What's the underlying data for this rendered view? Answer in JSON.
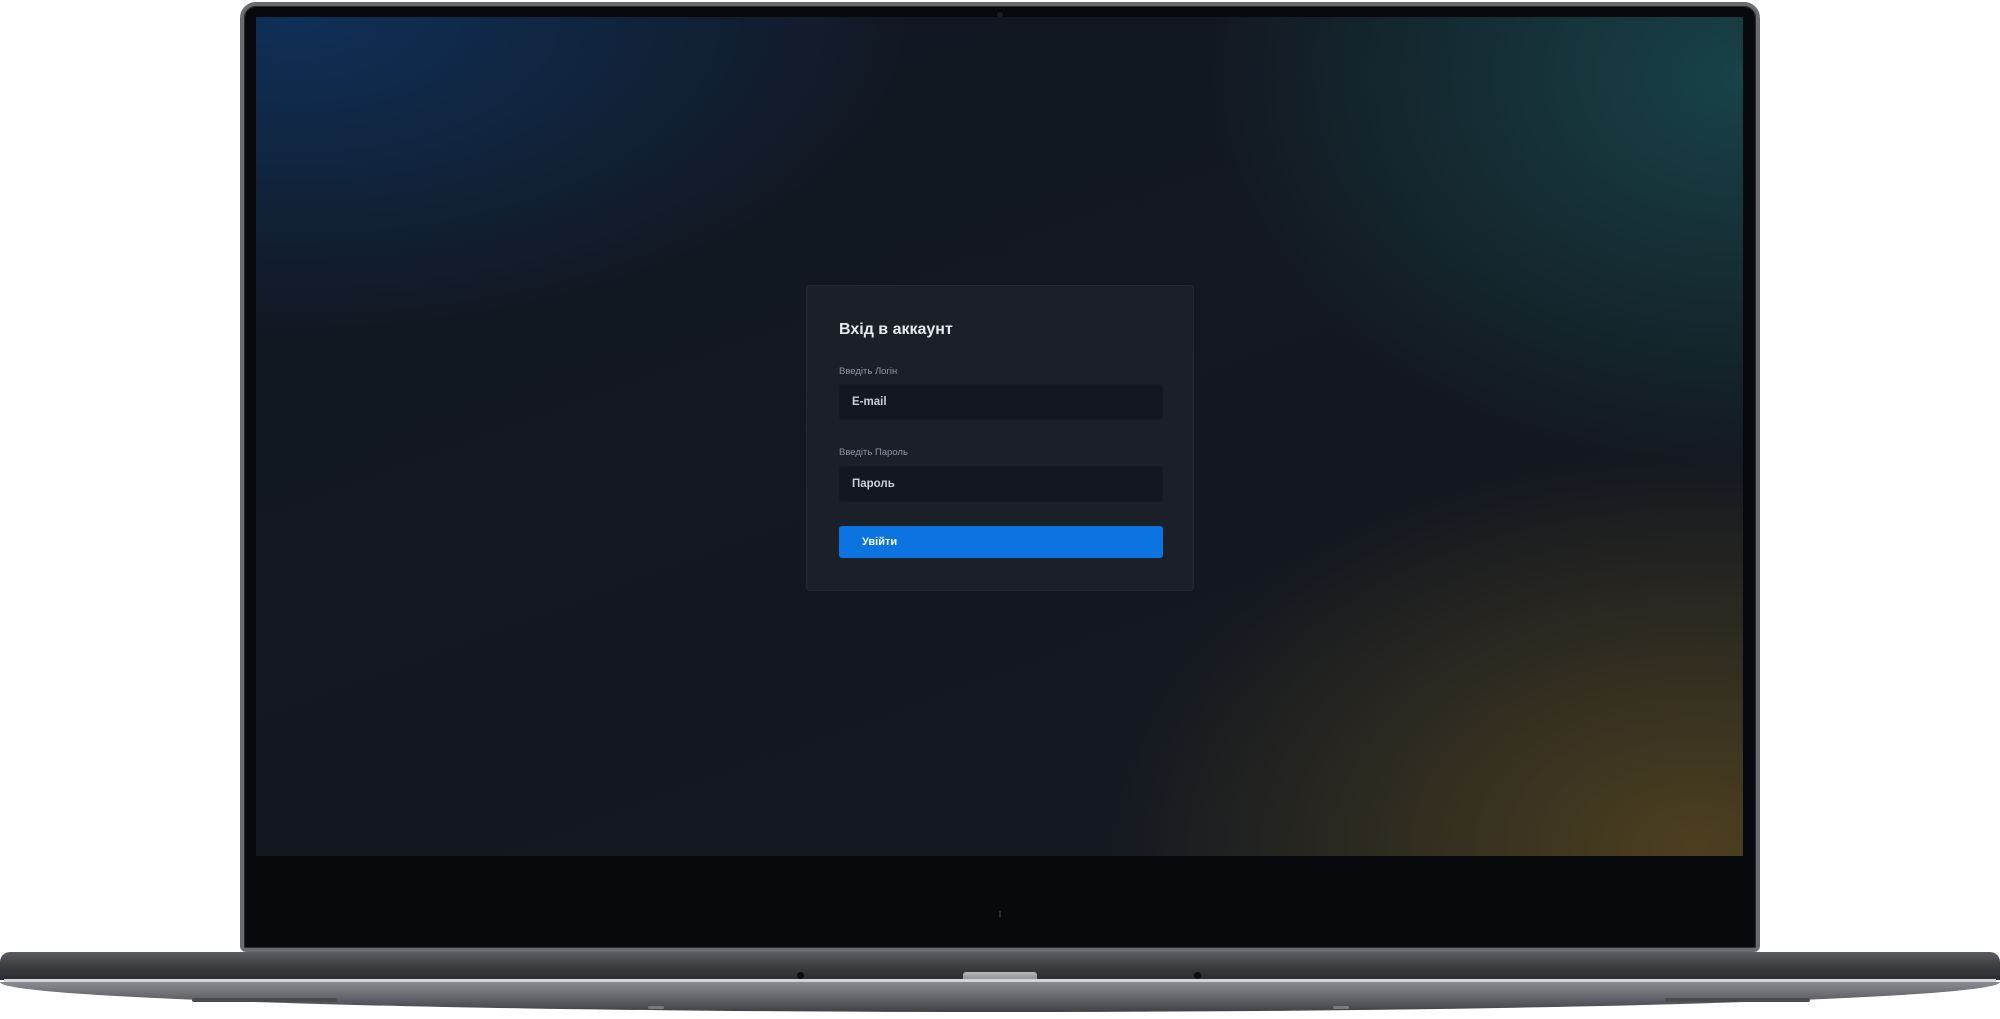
{
  "login": {
    "title": "Вхід в аккаунт",
    "login_label": "Введіть Логін",
    "login_placeholder": "E-mail",
    "password_label": "Введіть Пароль",
    "password_placeholder": "Пароль",
    "submit_label": "Увійти"
  },
  "colors": {
    "accent": "#0b74e0",
    "card_background": "#1b1f28",
    "input_background": "#131720",
    "screen_background": "#151922"
  }
}
